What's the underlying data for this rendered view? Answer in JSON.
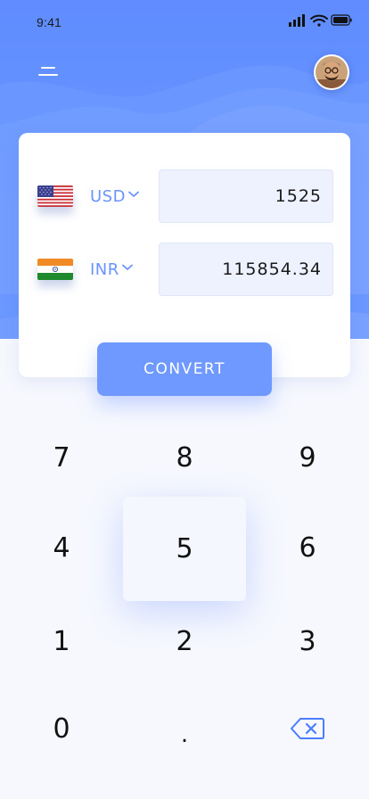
{
  "status_bar": {
    "time": "9:41"
  },
  "converter": {
    "from": {
      "currency": "USD",
      "amount": "1525"
    },
    "to": {
      "currency": "INR",
      "amount": "115854.34"
    },
    "convert_label": "CONVERT"
  },
  "keypad": {
    "keys": [
      "7",
      "8",
      "9",
      "4",
      "5",
      "6",
      "1",
      "2",
      "3",
      "0",
      "."
    ],
    "active_key": "5"
  },
  "icons": {
    "menu": "menu-icon",
    "avatar": "avatar",
    "backspace": "backspace-icon",
    "dropdown": "chevron-down-icon"
  },
  "colors": {
    "primary": "#6b93ff",
    "button": "#6f99ff",
    "background": "#f6f8fe"
  }
}
